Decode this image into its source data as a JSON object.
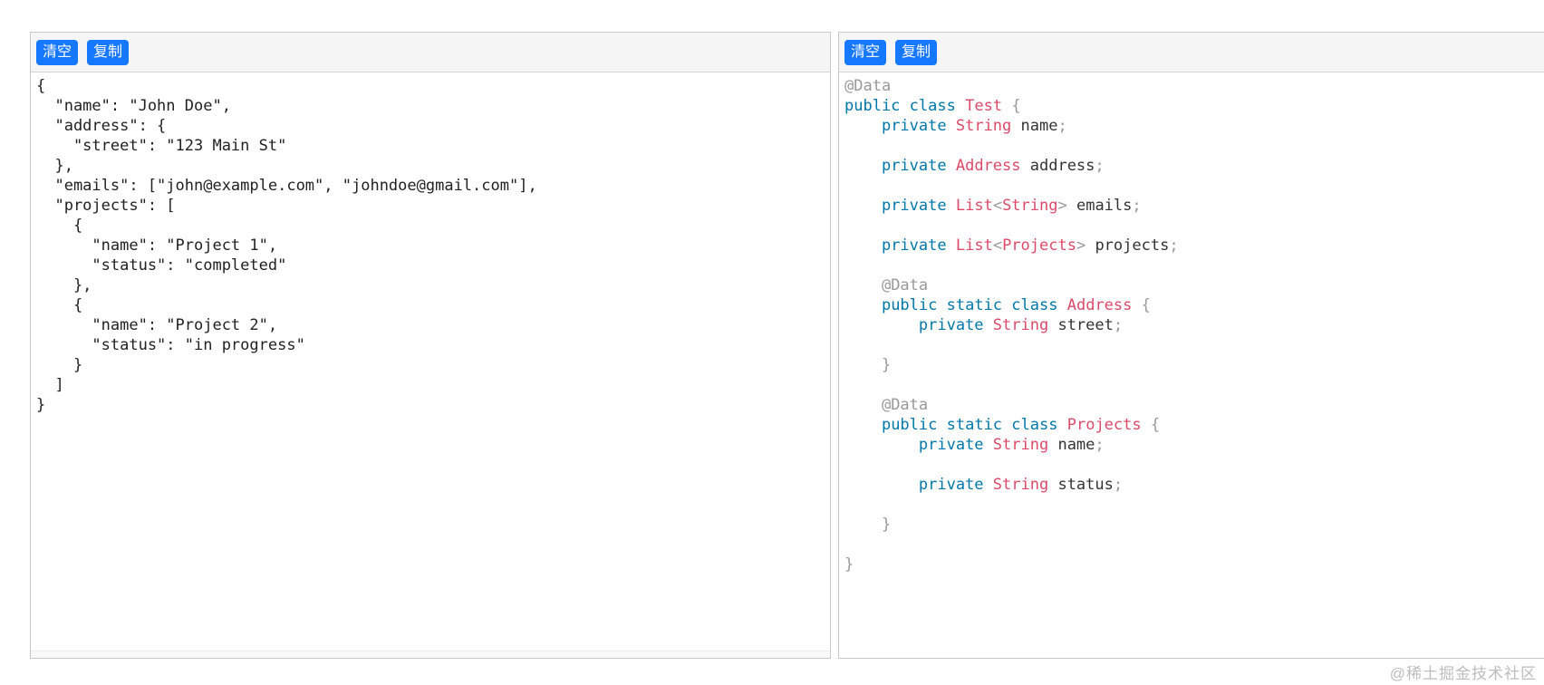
{
  "left_panel": {
    "toolbar": {
      "clear_label": "清空",
      "copy_label": "复制"
    },
    "json_lines": [
      "{",
      "  \"name\": \"John Doe\",",
      "  \"address\": {",
      "    \"street\": \"123 Main St\"",
      "  },",
      "  \"emails\": [\"john@example.com\", \"johndoe@gmail.com\"],",
      "  \"projects\": [",
      "    {",
      "      \"name\": \"Project 1\",",
      "      \"status\": \"completed\"",
      "    },",
      "    {",
      "      \"name\": \"Project 2\",",
      "      \"status\": \"in progress\"",
      "    }",
      "  ]",
      "}"
    ]
  },
  "right_panel": {
    "toolbar": {
      "clear_label": "清空",
      "copy_label": "复制"
    },
    "code_lines": [
      [
        [
          "annotation",
          "@Data"
        ]
      ],
      [
        [
          "keyword",
          "public"
        ],
        [
          "plain",
          " "
        ],
        [
          "keyword",
          "class"
        ],
        [
          "plain",
          " "
        ],
        [
          "class_name",
          "Test"
        ],
        [
          "plain",
          " "
        ],
        [
          "punctuation",
          "{"
        ]
      ],
      [
        [
          "plain",
          "    "
        ],
        [
          "keyword",
          "private"
        ],
        [
          "plain",
          " "
        ],
        [
          "class_name",
          "String"
        ],
        [
          "plain",
          " name"
        ],
        [
          "punctuation",
          ";"
        ]
      ],
      [],
      [
        [
          "plain",
          "    "
        ],
        [
          "keyword",
          "private"
        ],
        [
          "plain",
          " "
        ],
        [
          "class_name",
          "Address"
        ],
        [
          "plain",
          " address"
        ],
        [
          "punctuation",
          ";"
        ]
      ],
      [],
      [
        [
          "plain",
          "    "
        ],
        [
          "keyword",
          "private"
        ],
        [
          "plain",
          " "
        ],
        [
          "class_name",
          "List"
        ],
        [
          "punctuation",
          "<"
        ],
        [
          "class_name",
          "String"
        ],
        [
          "punctuation",
          ">"
        ],
        [
          "plain",
          " emails"
        ],
        [
          "punctuation",
          ";"
        ]
      ],
      [],
      [
        [
          "plain",
          "    "
        ],
        [
          "keyword",
          "private"
        ],
        [
          "plain",
          " "
        ],
        [
          "class_name",
          "List"
        ],
        [
          "punctuation",
          "<"
        ],
        [
          "class_name",
          "Projects"
        ],
        [
          "punctuation",
          ">"
        ],
        [
          "plain",
          " projects"
        ],
        [
          "punctuation",
          ";"
        ]
      ],
      [],
      [
        [
          "plain",
          "    "
        ],
        [
          "annotation",
          "@Data"
        ]
      ],
      [
        [
          "plain",
          "    "
        ],
        [
          "keyword",
          "public"
        ],
        [
          "plain",
          " "
        ],
        [
          "keyword",
          "static"
        ],
        [
          "plain",
          " "
        ],
        [
          "keyword",
          "class"
        ],
        [
          "plain",
          " "
        ],
        [
          "class_name",
          "Address"
        ],
        [
          "plain",
          " "
        ],
        [
          "punctuation",
          "{"
        ]
      ],
      [
        [
          "plain",
          "        "
        ],
        [
          "keyword",
          "private"
        ],
        [
          "plain",
          " "
        ],
        [
          "class_name",
          "String"
        ],
        [
          "plain",
          " street"
        ],
        [
          "punctuation",
          ";"
        ]
      ],
      [],
      [
        [
          "plain",
          "    "
        ],
        [
          "punctuation",
          "}"
        ]
      ],
      [],
      [
        [
          "plain",
          "    "
        ],
        [
          "annotation",
          "@Data"
        ]
      ],
      [
        [
          "plain",
          "    "
        ],
        [
          "keyword",
          "public"
        ],
        [
          "plain",
          " "
        ],
        [
          "keyword",
          "static"
        ],
        [
          "plain",
          " "
        ],
        [
          "keyword",
          "class"
        ],
        [
          "plain",
          " "
        ],
        [
          "class_name",
          "Projects"
        ],
        [
          "plain",
          " "
        ],
        [
          "punctuation",
          "{"
        ]
      ],
      [
        [
          "plain",
          "        "
        ],
        [
          "keyword",
          "private"
        ],
        [
          "plain",
          " "
        ],
        [
          "class_name",
          "String"
        ],
        [
          "plain",
          " name"
        ],
        [
          "punctuation",
          ";"
        ]
      ],
      [],
      [
        [
          "plain",
          "        "
        ],
        [
          "keyword",
          "private"
        ],
        [
          "plain",
          " "
        ],
        [
          "class_name",
          "String"
        ],
        [
          "plain",
          " status"
        ],
        [
          "punctuation",
          ";"
        ]
      ],
      [],
      [
        [
          "plain",
          "    "
        ],
        [
          "punctuation",
          "}"
        ]
      ],
      [],
      [
        [
          "punctuation",
          "}"
        ]
      ]
    ]
  },
  "code_colors": {
    "keyword": "#0077aa",
    "class_name": "#dd4a68",
    "punctuation": "#999999",
    "annotation": "#999999",
    "plain": "#333333"
  },
  "colors": {
    "button_bg": "#1677ff",
    "button_text": "#ffffff",
    "toolbar_bg": "#f5f5f5",
    "panel_border": "#c8c8c8",
    "json_text": "#222222",
    "watermark_text": "#bdbdbd"
  },
  "watermark": {
    "text": "@稀土掘金技术社区"
  }
}
